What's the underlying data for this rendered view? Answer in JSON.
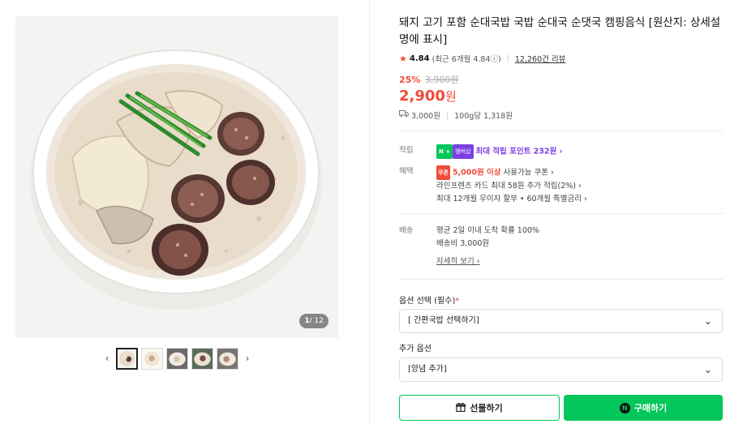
{
  "gallery": {
    "counter_current": "1",
    "counter_total": "/ 12",
    "prev_arrow": "‹",
    "next_arrow": "›",
    "thumbnail_count": 5
  },
  "product": {
    "title": "돼지 고기 포함 순대국밥 국밥 순대국 순댓국 캠핑음식 [원산지: 상세설명에 표시]",
    "rating_score": "4.84",
    "rating_recent": "(최근 6개월 4.84ⓘ)",
    "review_count": "12,260건 리뷰",
    "discount_rate": "25%",
    "original_price": "3,900원",
    "sale_price": "2,900",
    "sale_price_unit": "원",
    "shipping_fee_short": "3,000원",
    "unit_price": "100g당 1,318원"
  },
  "benefits": {
    "points_label": "적립",
    "points_badge_n": "N +",
    "points_badge_membership": "멤버십",
    "points_text": "최대 적립 포인트 232원 ›",
    "benefit_label": "혜택",
    "coupon_badge": "쿠폰",
    "coupon_strong": "5,000원 이상",
    "coupon_text": " 사용가능 쿠폰 ›",
    "card_text": "라인프렌즈 카드 최대 58원 추가 적립(2%) ›",
    "installment_text": "최대 12개월 무이자 할부 • 60개월 특별금리 ›"
  },
  "delivery": {
    "label": "배송",
    "arrival_text": "평균 2일 이내 도착 확률 100%",
    "fee_text": "배송비 3,000원",
    "detail_link": "자세히 보기 ›"
  },
  "options": {
    "required_label": "옵션 선택 (필수)",
    "required_mark": "*",
    "required_value": "[ 간편국밥 선택하기]",
    "extra_label": "추가 옵션",
    "extra_value": "[양념 추가]"
  },
  "actions": {
    "gift_label": "선물하기",
    "buy_label": "구매하기",
    "buy_icon_letter": "N"
  },
  "colors": {
    "accent_red": "#f04b3a",
    "naver_green": "#03c75a",
    "membership_purple": "#7b3fe4"
  }
}
